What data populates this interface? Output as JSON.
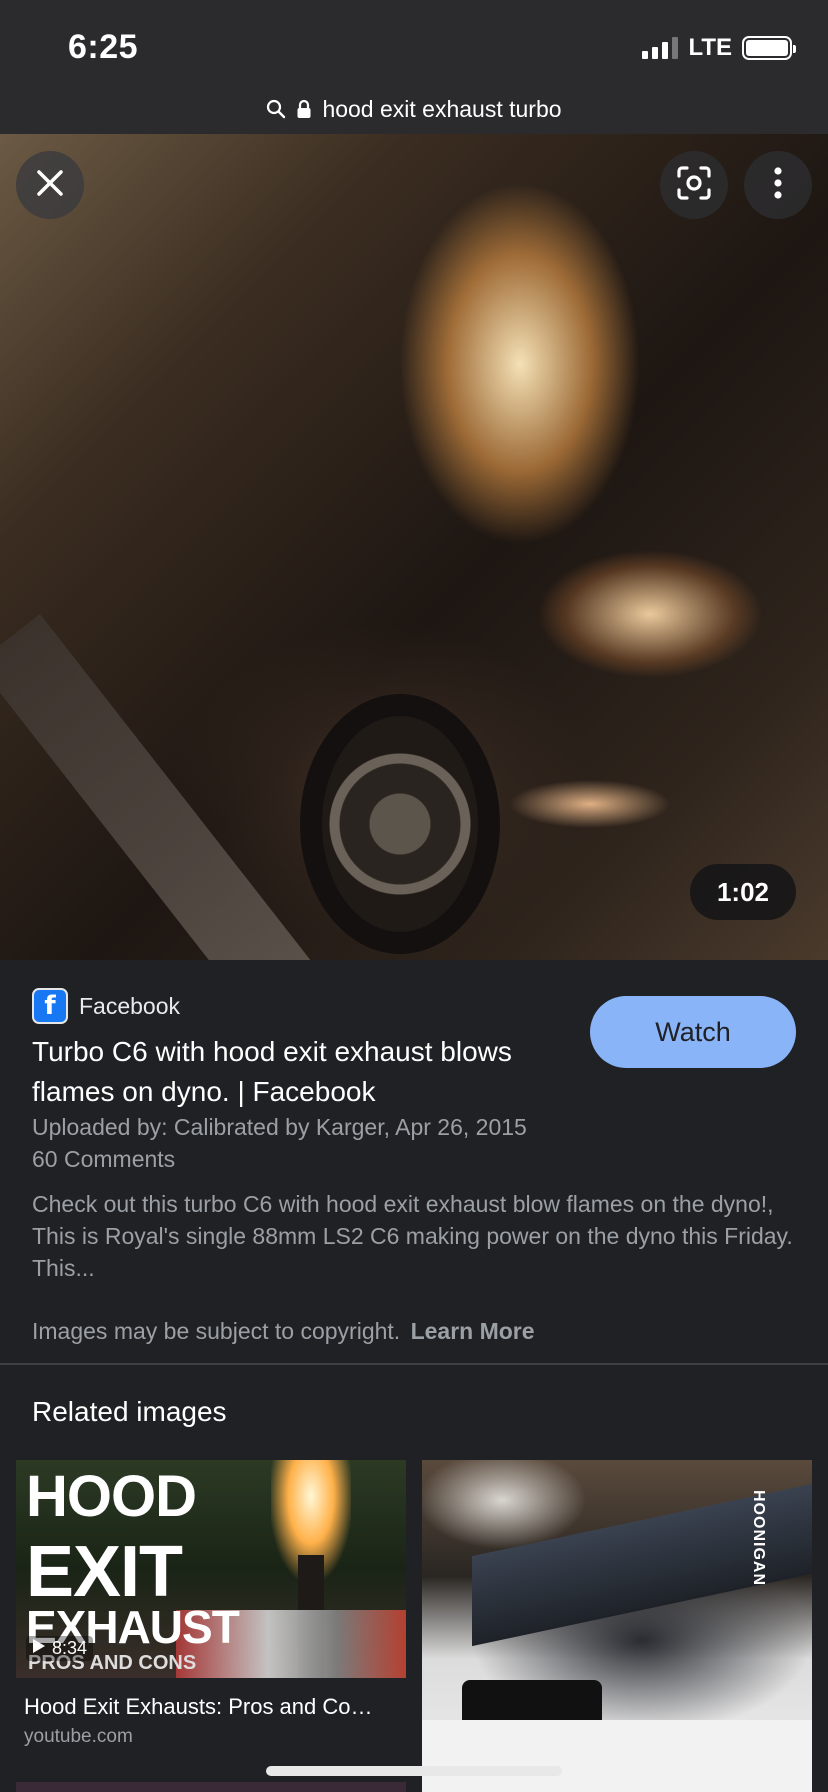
{
  "status_bar": {
    "time": "6:25",
    "network": "LTE"
  },
  "url_bar": {
    "query": "hood exit exhaust turbo"
  },
  "media": {
    "duration": "1:02"
  },
  "result": {
    "source": "Facebook",
    "watch_label": "Watch",
    "title": "Turbo C6 with hood exit exhaust blows flames on dyno. | Facebook",
    "uploaded_by": "Uploaded by: Calibrated by Karger, Apr 26, 2015",
    "comments": "60 Comments",
    "description": "Check out this turbo C6 with hood exit exhaust blow flames on the dyno!, This is Royal's single 88mm LS2 C6 making power on the dyno this Friday. This...",
    "copyright_text": "Images may be subject to copyright.",
    "learn_more": "Learn More"
  },
  "related": {
    "heading": "Related images",
    "items": [
      {
        "thumb_text": [
          "HOOD",
          "EXIT",
          "EXHAUST",
          "PROS AND CONS"
        ],
        "duration": "8:34",
        "title": "Hood Exit Exhausts: Pros and Co…",
        "site": "youtube.com"
      },
      {
        "thumb_text": [
          "HOONIGAN"
        ]
      }
    ]
  },
  "icons": {
    "close": "close-icon",
    "lens": "lens-icon",
    "more": "more-vert-icon",
    "search": "search-icon",
    "lock": "lock-icon",
    "play": "play-icon"
  },
  "colors": {
    "background": "#202124",
    "accent": "#8ab4f8",
    "facebook": "#1877f2"
  }
}
